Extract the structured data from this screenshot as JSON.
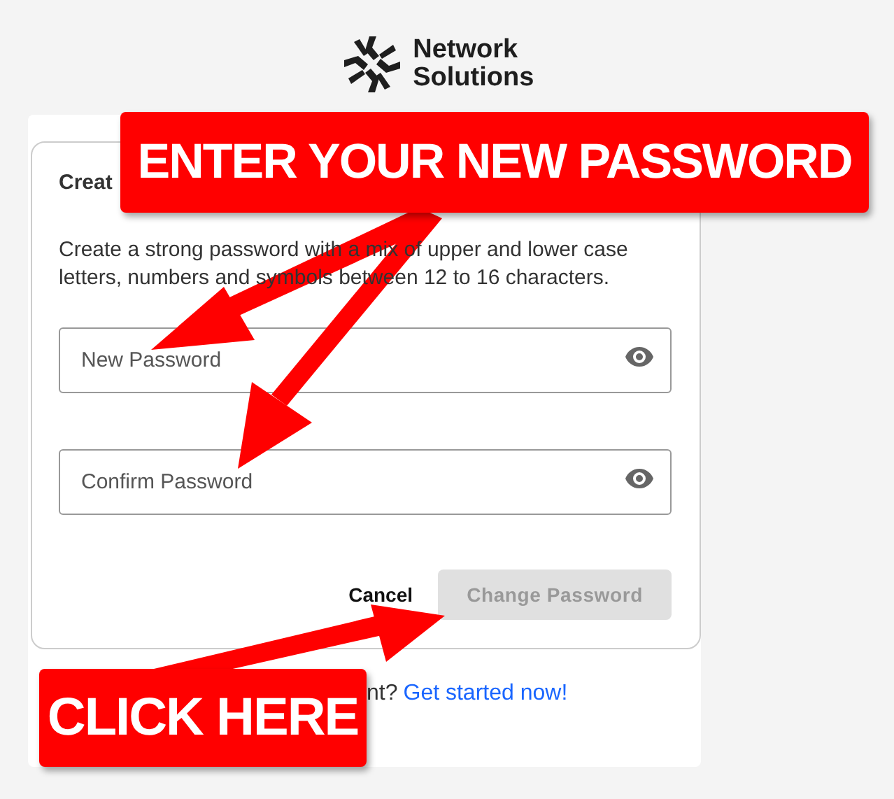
{
  "logo": {
    "text": "Network Solutions"
  },
  "card": {
    "title": "Creat",
    "description": "Create a strong password with a mix of upper and lower case letters, numbers and symbols between 12 to 16 characters.",
    "fields": [
      {
        "placeholder": "New Password"
      },
      {
        "placeholder": "Confirm Password"
      }
    ],
    "cancel": "Cancel",
    "submit": {
      "label": "Change Password",
      "disabled": true
    }
  },
  "footer": {
    "text": "nt?",
    "link": "Get started now!"
  },
  "annotations": [
    {
      "text": "ENTER YOUR NEW PASSWORD"
    },
    {
      "text": "CLICK HERE"
    }
  ]
}
